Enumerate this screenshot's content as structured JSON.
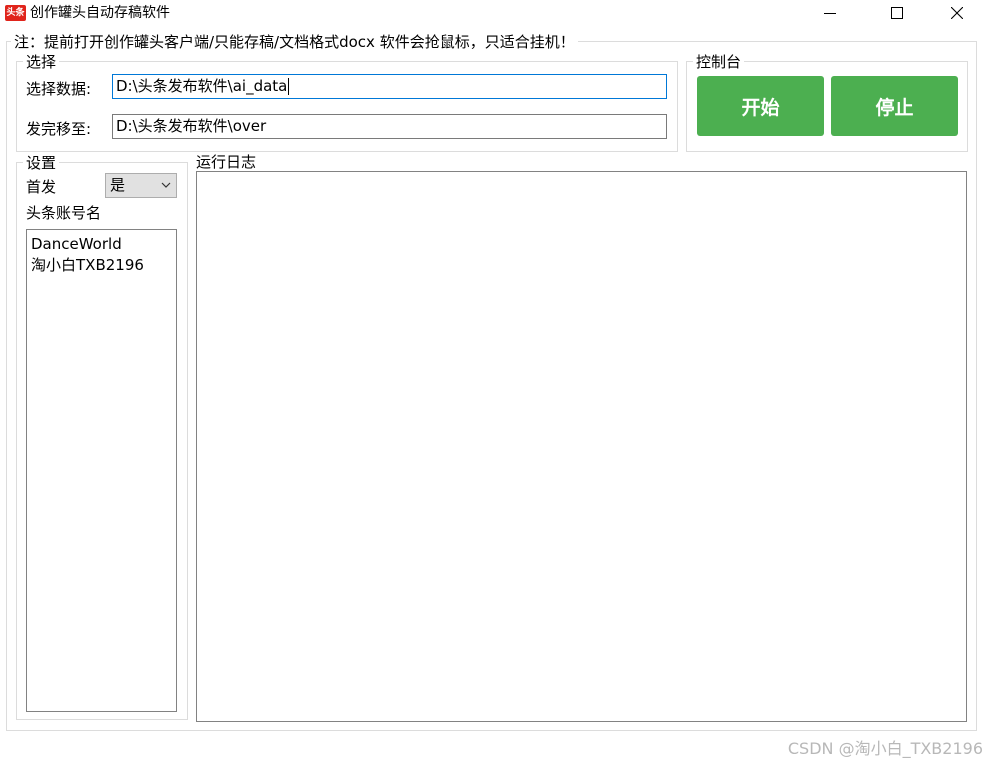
{
  "window": {
    "title": "创作罐头自动存稿软件",
    "icon_text": "头条"
  },
  "notice": "注：提前打开创作罐头客户端/只能存稿/文档格式docx 软件会抢鼠标，只适合挂机！",
  "select_group": {
    "legend": "选择",
    "data_label": "选择数据:",
    "data_path": "D:\\头条发布软件\\ai_data",
    "done_label": "发完移至:",
    "done_path": "D:\\头条发布软件\\over"
  },
  "console_group": {
    "legend": "控制台",
    "start_label": "开始",
    "stop_label": "停止",
    "button_color": "#4caf50"
  },
  "settings_group": {
    "legend": "设置",
    "first_publish_label": "首发",
    "first_publish_value": "是",
    "accounts_label": "头条账号名",
    "accounts": [
      "DanceWorld",
      "淘小白TXB2196"
    ]
  },
  "log": {
    "legend": "运行日志"
  },
  "watermark": "CSDN @淘小白_TXB2196"
}
